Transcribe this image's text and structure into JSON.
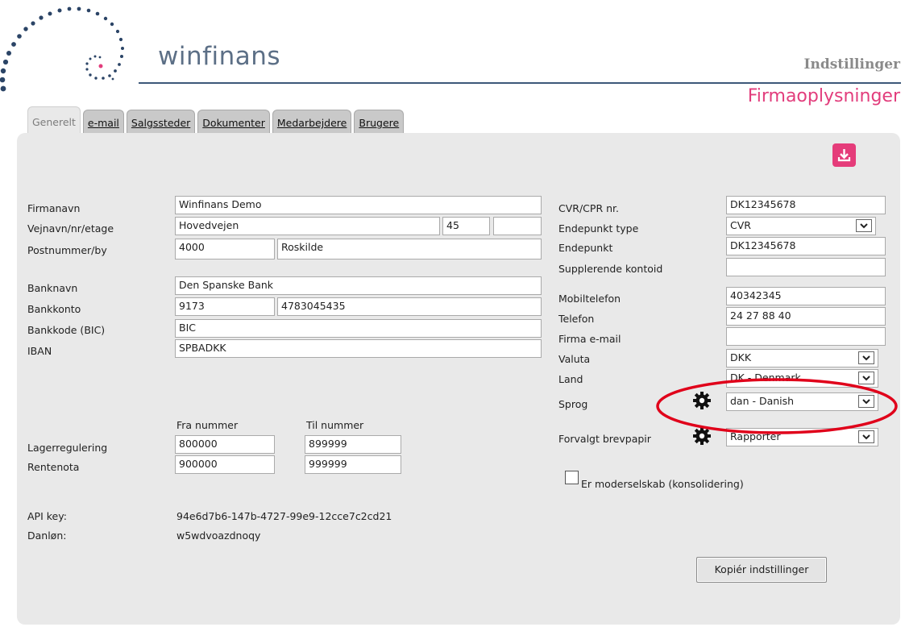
{
  "header": {
    "brand": "winfinans",
    "section": "Indstillinger",
    "page_title": "Firmaoplysninger"
  },
  "tabs": [
    {
      "label": "Generelt",
      "active": true
    },
    {
      "label": "e-mail"
    },
    {
      "label": "Salgssteder"
    },
    {
      "label": "Dokumenter"
    },
    {
      "label": "Medarbejdere"
    },
    {
      "label": "Brugere"
    }
  ],
  "left": {
    "firmanavn_label": "Firmanavn",
    "firmanavn": "Winfinans Demo",
    "vej_label": "Vejnavn/nr/etage",
    "vejnavn": "Hovedvejen",
    "husnr": "45",
    "etage": "",
    "postby_label": "Postnummer/by",
    "postnr": "4000",
    "by": "Roskilde",
    "banknavn_label": "Banknavn",
    "banknavn": "Den Spanske Bank",
    "bankkonto_label": "Bankkonto",
    "regnr": "9173",
    "kontonr": "4783045435",
    "bic_label": "Bankkode (BIC)",
    "bic": "BIC",
    "iban_label": "IBAN",
    "iban": "SPBADKK"
  },
  "numbers": {
    "fra_header": "Fra nummer",
    "til_header": "Til nummer",
    "rows": [
      {
        "label": "Lagerregulering",
        "fra": "800000",
        "til": "899999"
      },
      {
        "label": "Rentenota",
        "fra": "900000",
        "til": "999999"
      }
    ]
  },
  "api": {
    "api_key_label": "API key:",
    "api_key": "94e6d7b6-147b-4727-99e9-12cce7c2cd21",
    "danlon_label": "Danløn:",
    "danlon": "w5wdvoazdnoqy"
  },
  "right": {
    "cvr_label": "CVR/CPR nr.",
    "cvr": "DK12345678",
    "endepunkt_type_label": "Endepunkt type",
    "endepunkt_type": "CVR",
    "endepunkt_label": "Endepunkt",
    "endepunkt": "DK12345678",
    "suppl_label": "Supplerende kontoid",
    "suppl": "",
    "mobil_label": "Mobiltelefon",
    "mobil": "40342345",
    "telefon_label": "Telefon",
    "telefon": "24 27 88 40",
    "email_label": "Firma e-mail",
    "email": "",
    "valuta_label": "Valuta",
    "valuta": "DKK",
    "land_label": "Land",
    "land": "DK - Denmark",
    "sprog_label": "Sprog",
    "sprog": "dan - Danish",
    "brevpapir_label": "Forvalgt brevpapir",
    "brevpapir": "Rapporter",
    "moderselskab_label": "Er moderselskab (konsolidering)",
    "moderselskab_checked": false
  },
  "actions": {
    "copy_label": "Kopiér indstillinger"
  },
  "colors": {
    "accent": "#e53c7a",
    "brand_text": "#5c6f86",
    "rule": "#3d5879",
    "annotation": "#e0001a"
  },
  "icons": [
    "logo-dots",
    "download-icon",
    "gear-icon",
    "chevron-down-icon"
  ]
}
